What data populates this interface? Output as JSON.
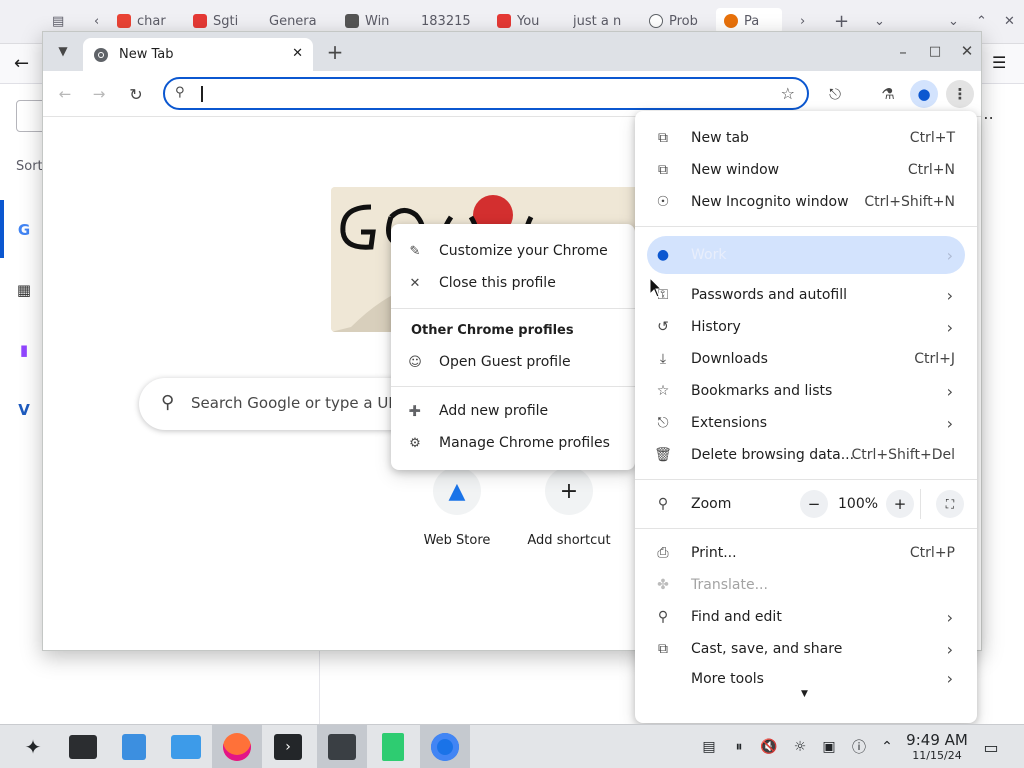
{
  "background_window": {
    "tabs": [
      {
        "label": "char",
        "color": "#ea4335"
      },
      {
        "label": "Sgti",
        "color": "#e53935"
      },
      {
        "label": "Genera",
        "color": "#9aa0a6"
      },
      {
        "label": "Win",
        "color": "#333333"
      },
      {
        "label": "183215",
        "color": "#9aa0a6"
      },
      {
        "label": "You",
        "color": "#e53935"
      },
      {
        "label": "just a n",
        "color": "#9aa0a6"
      },
      {
        "label": "Prob",
        "color": "#5f6368"
      },
      {
        "label": "Pa",
        "color": "#e8710a"
      }
    ],
    "sidebar_left_text": "Sort",
    "side_icons": [
      "G",
      "▦",
      "▮",
      "V"
    ]
  },
  "chrome": {
    "tab_title": "New Tab",
    "omnibox_value": "",
    "search_placeholder": "Search Google or type a URL",
    "shortcuts": [
      {
        "label": "Web Store"
      },
      {
        "label": "Add shortcut"
      }
    ]
  },
  "profile_submenu": {
    "items_top": [
      {
        "icon": "pencil-icon",
        "glyph": "✎",
        "label": "Customize your Chrome"
      },
      {
        "icon": "close-icon",
        "glyph": "✕",
        "label": "Close this profile"
      }
    ],
    "section_heading": "Other Chrome profiles",
    "guest": {
      "icon": "guest-icon",
      "glyph": "☺",
      "label": "Open Guest profile"
    },
    "items_bottom": [
      {
        "icon": "add-person-icon",
        "glyph": "➕",
        "label": "Add new profile"
      },
      {
        "icon": "manage-profiles-icon",
        "glyph": "⚙",
        "label": "Manage Chrome profiles"
      }
    ]
  },
  "menu": {
    "new_tab": {
      "label": "New tab",
      "shortcut": "Ctrl+T"
    },
    "new_window": {
      "label": "New window",
      "shortcut": "Ctrl+N"
    },
    "new_incognito": {
      "label": "New Incognito window",
      "shortcut": "Ctrl+Shift+N"
    },
    "profile": {
      "label": "Work"
    },
    "passwords": {
      "label": "Passwords and autofill"
    },
    "history": {
      "label": "History"
    },
    "downloads": {
      "label": "Downloads",
      "shortcut": "Ctrl+J"
    },
    "bookmarks": {
      "label": "Bookmarks and lists"
    },
    "extensions": {
      "label": "Extensions"
    },
    "delete_data": {
      "label": "Delete browsing data...",
      "shortcut": "Ctrl+Shift+Del"
    },
    "zoom": {
      "label": "Zoom",
      "value": "100%",
      "minus": "−",
      "plus": "+"
    },
    "print": {
      "label": "Print...",
      "shortcut": "Ctrl+P"
    },
    "translate": {
      "label": "Translate..."
    },
    "find_edit": {
      "label": "Find and edit"
    },
    "cast_save": {
      "label": "Cast, save, and share"
    },
    "more_tools": {
      "label": "More tools"
    }
  },
  "taskbar": {
    "time": "9:49 AM",
    "date": "11/15/24"
  },
  "colors": {
    "accent": "#0b57d0",
    "highlight": "#d3e3fd"
  }
}
